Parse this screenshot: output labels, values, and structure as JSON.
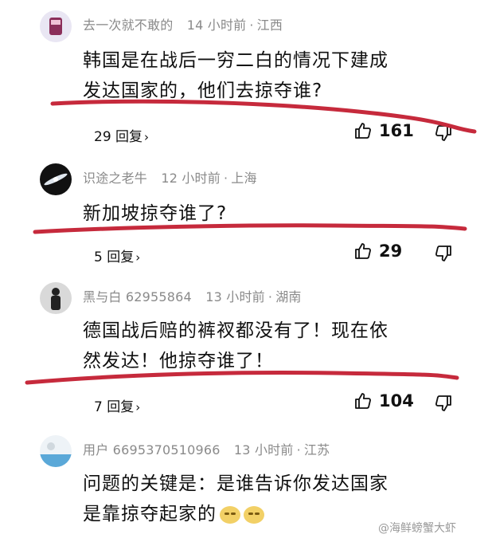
{
  "comments": [
    {
      "user": "去一次就不敢的",
      "time": "14 小时前",
      "location": "江西",
      "text_line1": "韩国是在战后一穷二白的情况下建成",
      "text_line2": "发达国家的，他们去掠夺谁?",
      "replies": "29 回复",
      "likes": "161"
    },
    {
      "user": "识途之老牛",
      "time": "12 小时前",
      "location": "上海",
      "text_line1": "新加坡掠夺谁了?",
      "replies": "5 回复",
      "likes": "29"
    },
    {
      "user": "黑与白 62955864",
      "time": "13 小时前",
      "location": "湖南",
      "text_line1": "德国战后赔的裤衩都没有了！现在依",
      "text_line2": "然发达！他掠夺谁了！",
      "replies": "7 回复",
      "likes": "104"
    },
    {
      "user": "用户 6695370510966",
      "time": "13 小时前",
      "location": "江苏",
      "text_line1": "问题的关键是：是谁告诉你发达国家",
      "text_line2": "是靠掠夺起家的"
    }
  ],
  "separator": "·",
  "chevron": "›",
  "icons": {
    "like": "thumbs-up-icon",
    "dislike": "thumbs-down-icon",
    "emoji": "smirk-emoji-icon"
  },
  "colors": {
    "annotation_red": "#c62a3c",
    "meta_gray": "#8a8a8a"
  },
  "watermark": "@海鲜螃蟹大虾"
}
